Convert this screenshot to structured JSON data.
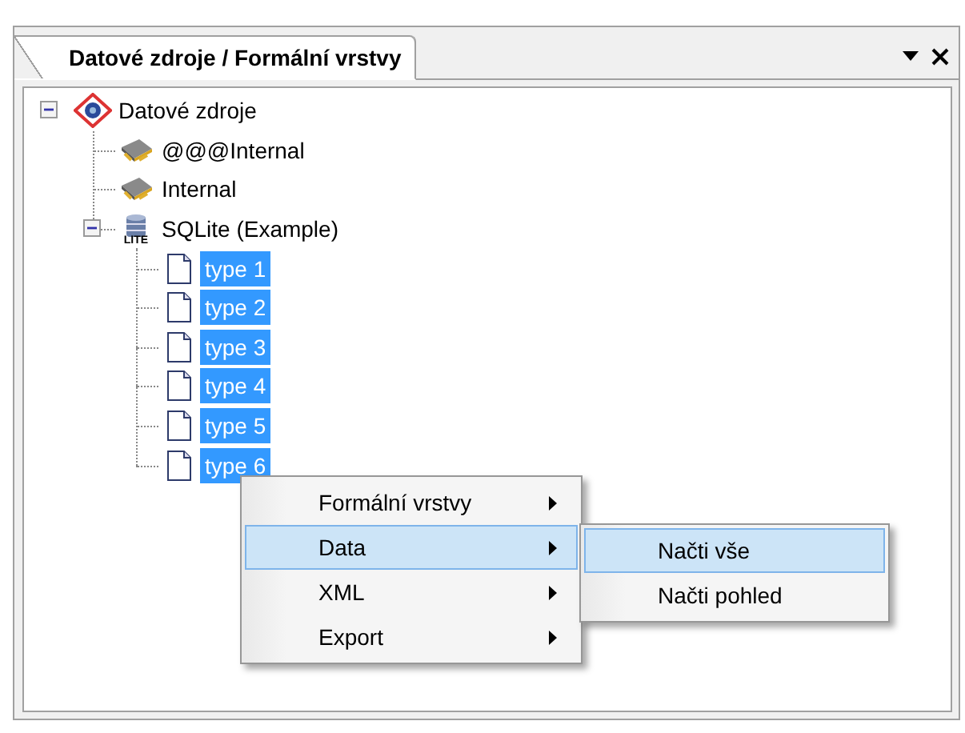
{
  "panel": {
    "tab": {
      "label": "Datové zdroje / Formální vrstvy",
      "selected": true
    }
  },
  "tree": [
    {
      "label": "Datové zdroje",
      "kind": "root",
      "expanded": true,
      "selected": false,
      "children": [
        {
          "label": "@@@Internal",
          "kind": "chip",
          "selected": false
        },
        {
          "label": "Internal",
          "kind": "chip",
          "selected": false
        },
        {
          "label": "SQLite (Example)",
          "kind": "database",
          "badge": "LITE",
          "expanded": true,
          "selected": false,
          "children": [
            {
              "label": "type 1",
              "kind": "document",
              "selected": true
            },
            {
              "label": "type 2",
              "kind": "document",
              "selected": true
            },
            {
              "label": "type 3",
              "kind": "document",
              "selected": true
            },
            {
              "label": "type 4",
              "kind": "document",
              "selected": true
            },
            {
              "label": "type 5",
              "kind": "document",
              "selected": true
            },
            {
              "label": "type 6",
              "kind": "document",
              "selected": true
            }
          ]
        }
      ]
    }
  ],
  "context_menu": {
    "items": [
      {
        "label": "Formální vrstvy",
        "has_submenu": true,
        "highlighted": false
      },
      {
        "label": "Data",
        "has_submenu": true,
        "highlighted": true
      },
      {
        "label": "XML",
        "has_submenu": true,
        "highlighted": false
      },
      {
        "label": "Export",
        "has_submenu": true,
        "highlighted": false
      }
    ],
    "submenu": {
      "items": [
        {
          "label": "Načti vše",
          "highlighted": true
        },
        {
          "label": "Načti pohled",
          "highlighted": false
        }
      ]
    }
  }
}
